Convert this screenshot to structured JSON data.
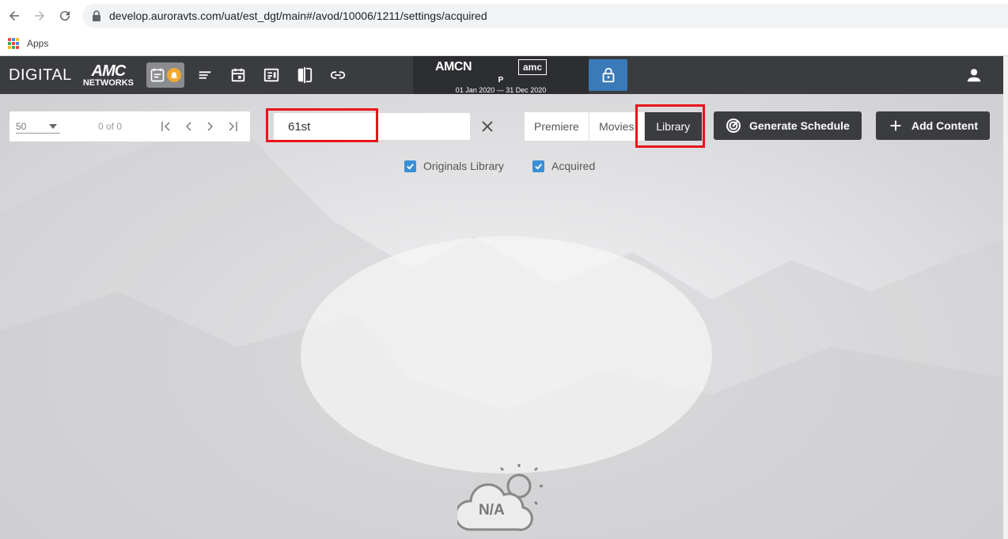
{
  "browser": {
    "url": "develop.auroravts.com/uat/est_dgt/main#/avod/10006/1211/settings/acquired",
    "bookmarks_label": "Apps"
  },
  "header": {
    "brand_digital": "DIGITAL",
    "brand_amc_top": "AMC",
    "brand_amc_bottom": "NETWORKS",
    "channel": {
      "network": "AMCN",
      "logo": "amc",
      "plan": "P",
      "dates": "01 Jan 2020 — 31 Dec 2020"
    }
  },
  "toolbar": {
    "page_size": "50",
    "page_count": "0 of 0",
    "search_value": "61st",
    "segments": [
      "Premiere",
      "Movies",
      "Library"
    ],
    "active_segment": "Library",
    "generate_label": "Generate Schedule",
    "add_label": "Add Content"
  },
  "filters": {
    "originals_label": "Originals Library",
    "originals_checked": true,
    "acquired_label": "Acquired",
    "acquired_checked": true
  },
  "empty_state": {
    "label": "N/A"
  },
  "colors": {
    "header_bg": "#3b3c40",
    "accent_blue": "#3a7ab8",
    "checkbox": "#3b8fd6",
    "highlight": "#e8141b",
    "badge": "#f0a830"
  }
}
